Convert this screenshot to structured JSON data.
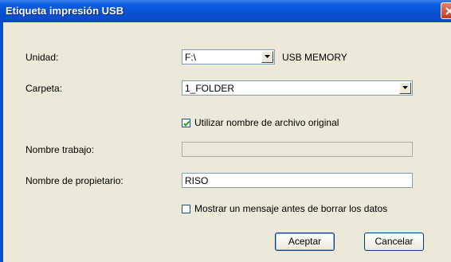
{
  "window": {
    "title": "Etiqueta impresión USB"
  },
  "unit": {
    "label": "Unidad:",
    "value": "F:\\",
    "description": "USB MEMORY"
  },
  "folder": {
    "label": "Carpeta:",
    "value": "1_FOLDER"
  },
  "use_original_name": {
    "label": "Utilizar nombre de archivo original",
    "checked": true
  },
  "job_name": {
    "label": "Nombre trabajo:",
    "value": ""
  },
  "owner_name": {
    "label": "Nombre de propietario:",
    "value": "RISO"
  },
  "confirm_delete": {
    "label": "Mostrar un mensaje antes de borrar los datos",
    "checked": false
  },
  "buttons": {
    "ok": "Aceptar",
    "cancel": "Cancelar"
  },
  "colors": {
    "titlebar": "#0a5fe0",
    "client_bg": "#ece9d8",
    "close_button": "#c2391f"
  }
}
